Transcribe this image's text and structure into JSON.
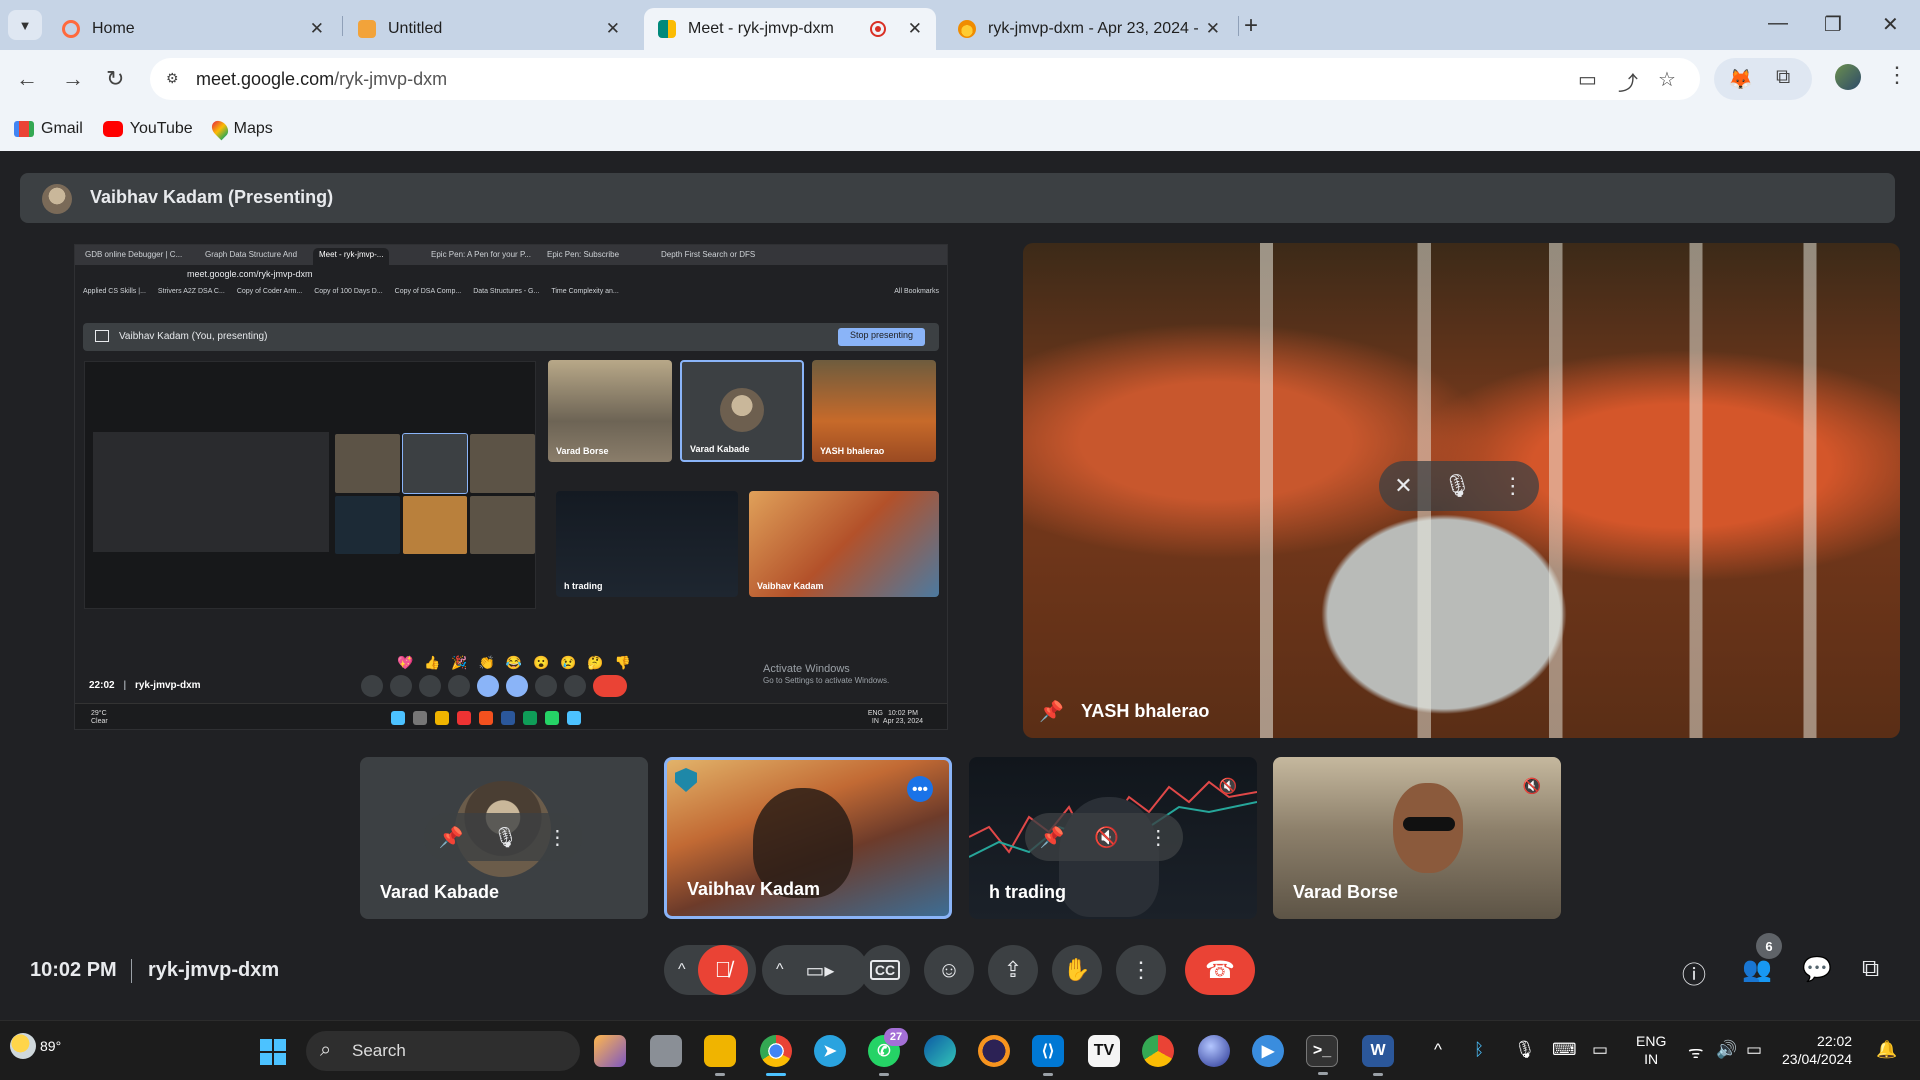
{
  "tabs": [
    {
      "title": "Home",
      "favicon_color": "#ff6a3d"
    },
    {
      "title": "Untitled",
      "favicon_color": "#f2a33a"
    },
    {
      "title": "Meet - ryk-jmvp-dxm",
      "favicon_color": "#00897b",
      "recording": true
    },
    {
      "title": "ryk-jmvp-dxm - Apr 23, 2024 -",
      "favicon_color": "#f4b400"
    }
  ],
  "address": {
    "host": "meet.google.com",
    "path": "/ryk-jmvp-dxm"
  },
  "bookmarks": [
    "Gmail",
    "YouTube",
    "Maps"
  ],
  "presenter_bar": {
    "name": "Vaibhav Kadam (Presenting)"
  },
  "share": {
    "tabs": [
      "GDB online Debugger | C...",
      "Graph Data Structure And",
      "Meet - ryk-jmvp-...",
      "Epic Pen: A Pen for your P...",
      "Epic Pen: Subscribe",
      "Depth First Search or DFS"
    ],
    "url": "meet.google.com/ryk-jmvp-dxm",
    "bookmarks": [
      "Applied CS Skills |...",
      "Strivers A2Z DSA C...",
      "Copy of Coder Arm...",
      "Copy of 100 Days D...",
      "Copy of DSA Comp...",
      "Data Structures - G...",
      "Time Complexity an...",
      "All Bookmarks"
    ],
    "presenting_text": "Vaibhav Kadam (You, presenting)",
    "stop_label": "Stop presenting",
    "tiles": [
      {
        "name": "Varad Borse"
      },
      {
        "name": "Varad Kabade"
      },
      {
        "name": "YASH bhalerao"
      },
      {
        "name": "h trading"
      },
      {
        "name": "Vaibhav Kadam"
      }
    ],
    "emojis": [
      "💖",
      "👍",
      "🎉",
      "👏",
      "😂",
      "😮",
      "😢",
      "🤔",
      "👎"
    ],
    "time": "22:02",
    "code": "ryk-jmvp-dxm",
    "activate_title": "Activate Windows",
    "activate_sub": "Go to Settings to activate Windows.",
    "weather": "29°C",
    "weather_sub": "Clear",
    "lang": "ENG",
    "lang_sub": "IN",
    "clock_time": "10:02 PM",
    "clock_date": "Apr 23, 2024"
  },
  "main_video": {
    "name": "YASH bhalerao"
  },
  "participants": [
    {
      "name": "Varad Kabade"
    },
    {
      "name": "Vaibhav Kadam"
    },
    {
      "name": "h trading"
    },
    {
      "name": "Varad Borse"
    }
  ],
  "bottom": {
    "time": "10:02 PM",
    "meeting_code": "ryk-jmvp-dxm",
    "people_count": "6"
  },
  "taskbar": {
    "weather": "89°",
    "search_placeholder": "Search",
    "whatsapp_badge": "27",
    "lang": "ENG",
    "lang_sub": "IN",
    "time": "22:02",
    "date": "23/04/2024"
  },
  "colors": {
    "meet_bg": "#202124",
    "end_call": "#ea4335",
    "accent": "#8ab4f8",
    "taskbar": "#1c1c1c"
  }
}
